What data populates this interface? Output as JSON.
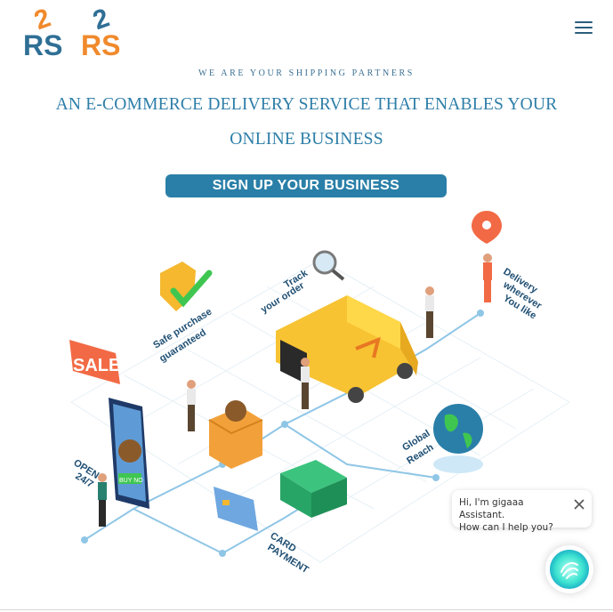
{
  "brand": {
    "logo_text": "2RS 2RS"
  },
  "hero": {
    "tagline": "WE ARE YOUR SHIPPING PARTNERS",
    "headline": "AN E-COMMERCE DELIVERY SERVICE THAT ENABLES YOUR ONLINE BUSINESS",
    "cta_label": "SIGN UP YOUR BUSINESS"
  },
  "illustration": {
    "labels": {
      "safe_purchase_1": "Safe purchase",
      "safe_purchase_2": "guaranteed",
      "track_1": "Track",
      "track_2": "your order",
      "delivery_1": "Delivery",
      "delivery_2": "wherever",
      "delivery_3": "You like",
      "sale": "SALE",
      "open_1": "OPEN",
      "open_2": "24/7",
      "global_1": "Global",
      "global_2": "Reach",
      "card_1": "CARD",
      "card_2": "PAYMENT",
      "buy_now": "BUY NO"
    }
  },
  "chat": {
    "line1": "Hi, I'm gigaaa Assistant.",
    "line2": "How can I help you?"
  },
  "colors": {
    "accent": "#2a7fa8",
    "headline": "#2d7ea8",
    "logo_orange": "#f08a2c",
    "logo_blue": "#2f6f95"
  },
  "icons": [
    "menu-icon",
    "close-icon",
    "chat-assistant-icon",
    "location-pin-icon",
    "magnifier-icon",
    "shield-check-icon",
    "globe-icon"
  ]
}
